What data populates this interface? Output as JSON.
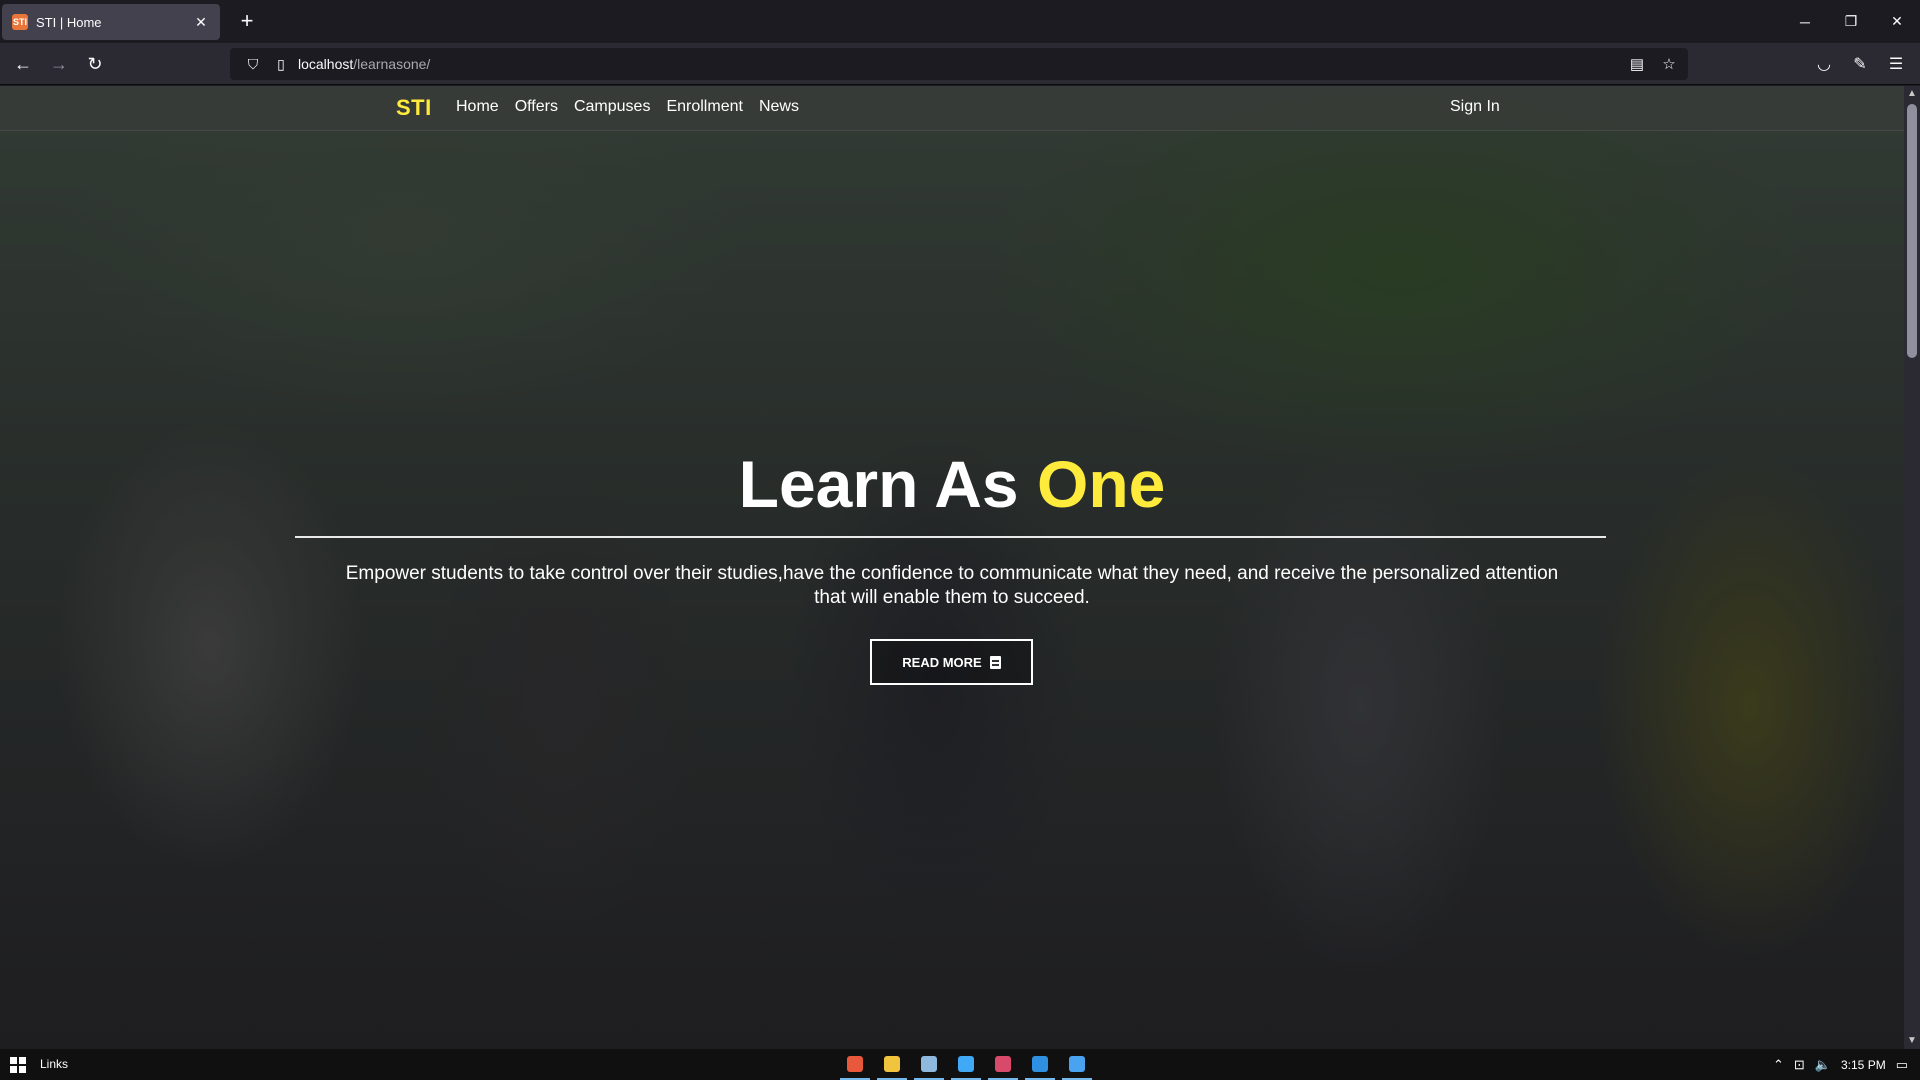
{
  "browser": {
    "tab_title": "STI | Home",
    "tab_favicon": "STI",
    "new_tab": "+",
    "url_host": "localhost",
    "url_path": "/learnasone/",
    "window_controls": [
      "minimize-icon",
      "restore-icon",
      "close-icon"
    ]
  },
  "site": {
    "brand": "STI",
    "menu": [
      "Home",
      "Offers",
      "Campuses",
      "Enrollment",
      "News"
    ],
    "signin": "Sign In"
  },
  "hero": {
    "headline_main": "Learn As ",
    "headline_accent": "One",
    "tagline": "Empower students to take control over their studies,have the confidence to communicate what they need, and receive the personalized attention that will enable them to succeed.",
    "cta_label": "READ MORE"
  },
  "taskbar": {
    "links_label": "Links",
    "time": "3:15 PM",
    "apps": [
      {
        "name": "brave-icon",
        "color": "#e8583a"
      },
      {
        "name": "file-explorer-icon",
        "color": "#f0c43c"
      },
      {
        "name": "notepad-icon",
        "color": "#8fb8de"
      },
      {
        "name": "this-pc-icon",
        "color": "#3fa9f5"
      },
      {
        "name": "mail-app-icon",
        "color": "#d94a6a"
      },
      {
        "name": "vscode-icon",
        "color": "#2f8fe0"
      },
      {
        "name": "firefox-icon",
        "color": "#4aa3f0"
      }
    ]
  },
  "colors": {
    "accent": "#ffeb3b",
    "chrome_dark": "#1c1b22",
    "chrome_toolbar": "#2b2a33"
  }
}
